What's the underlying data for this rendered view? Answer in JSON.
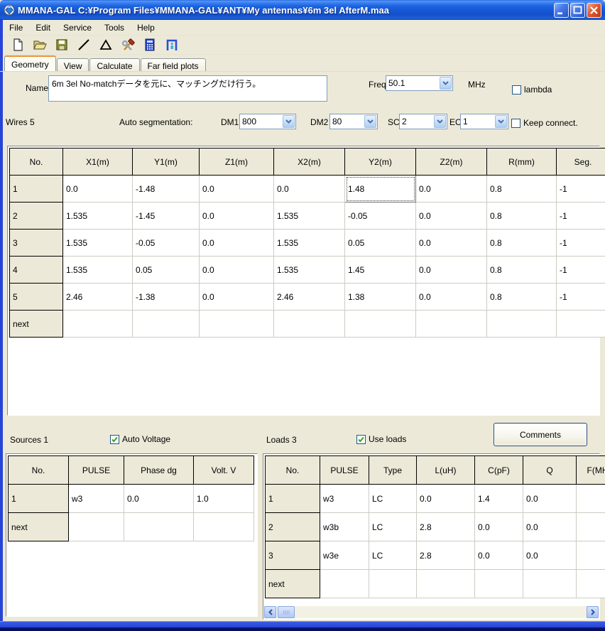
{
  "window": {
    "title": "MMANA-GAL C:¥Program Files¥MMANA-GAL¥ANT¥My antennas¥6m 3el AfterM.maa",
    "controls": [
      "minimize",
      "maximize",
      "close"
    ]
  },
  "menu": {
    "items": [
      "File",
      "Edit",
      "Service",
      "Tools",
      "Help"
    ]
  },
  "toolbar": {
    "icons": [
      "new-file-icon",
      "open-file-icon",
      "save-icon",
      "wire-edit-icon",
      "antenna-view-icon",
      "setup-tools-icon",
      "calculator-icon",
      "plot-viewer-icon"
    ]
  },
  "tabs": [
    {
      "label": "Geometry",
      "active": true
    },
    {
      "label": "View",
      "active": false
    },
    {
      "label": "Calculate",
      "active": false
    },
    {
      "label": "Far field plots",
      "active": false
    }
  ],
  "geometry": {
    "name_label": "Name",
    "name_value": "6m 3el No-matchデータを元に、マッチングだけ行う。",
    "freq_label": "Freq",
    "freq_value": "50.1",
    "freq_unit": "MHz",
    "lambda_label": "lambda",
    "lambda_checked": false,
    "wires_label": "Wires 5",
    "autoseg_label": "Auto segmentation:",
    "dm1_label": "DM1",
    "dm1_value": "800",
    "dm2_label": "DM2",
    "dm2_value": "80",
    "sc_label": "SC",
    "sc_value": "2",
    "ec_label": "EC",
    "ec_value": "1",
    "keep_connect_label": "Keep connect.",
    "keep_connect_checked": false
  },
  "wire_table": {
    "headers": [
      "No.",
      "X1(m)",
      "Y1(m)",
      "Z1(m)",
      "X2(m)",
      "Y2(m)",
      "Z2(m)",
      "R(mm)",
      "Seg."
    ],
    "rows": [
      [
        "1",
        "0.0",
        "-1.48",
        "0.0",
        "0.0",
        "1.48",
        "0.0",
        "0.8",
        "-1"
      ],
      [
        "2",
        "1.535",
        "-1.45",
        "0.0",
        "1.535",
        "-0.05",
        "0.0",
        "0.8",
        "-1"
      ],
      [
        "3",
        "1.535",
        "-0.05",
        "0.0",
        "1.535",
        "0.05",
        "0.0",
        "0.8",
        "-1"
      ],
      [
        "4",
        "1.535",
        "0.05",
        "0.0",
        "1.535",
        "1.45",
        "0.0",
        "0.8",
        "-1"
      ],
      [
        "5",
        "2.46",
        "-1.38",
        "0.0",
        "2.46",
        "1.38",
        "0.0",
        "0.8",
        "-1"
      ],
      [
        "next",
        "",
        "",
        "",
        "",
        "",
        "",
        "",
        ""
      ]
    ],
    "selected": {
      "row": 0,
      "col": 5
    }
  },
  "sources": {
    "label": "Sources 1",
    "auto_voltage_label": "Auto Voltage",
    "auto_voltage_checked": true,
    "table": {
      "headers": [
        "No.",
        "PULSE",
        "Phase dg",
        "Volt. V"
      ],
      "rows": [
        [
          "1",
          "w3",
          "0.0",
          "1.0"
        ],
        [
          "next",
          "",
          "",
          ""
        ]
      ]
    }
  },
  "loads": {
    "label": "Loads 3",
    "use_loads_label": "Use loads",
    "use_loads_checked": true,
    "comments_label": "Comments",
    "table": {
      "headers": [
        "No.",
        "PULSE",
        "Type",
        "L(uH)",
        "C(pF)",
        "Q",
        "F(MHz)"
      ],
      "rows": [
        [
          "1",
          "w3",
          "LC",
          "0.0",
          "1.4",
          "0.0",
          ""
        ],
        [
          "2",
          "w3b",
          "LC",
          "2.8",
          "0.0",
          "0.0",
          ""
        ],
        [
          "3",
          "w3e",
          "LC",
          "2.8",
          "0.0",
          "0.0",
          ""
        ],
        [
          "next",
          "",
          "",
          "",
          "",
          "",
          ""
        ]
      ]
    }
  },
  "colors": {
    "titlebar_blue": "#2663E2",
    "window_face": "#ECE9D8",
    "close_red": "#D2492A",
    "tab_accent_orange": "#E5953B",
    "check_green": "#21A121",
    "grid_line": "#CCCCC3",
    "border_blue": "#2744D8"
  }
}
